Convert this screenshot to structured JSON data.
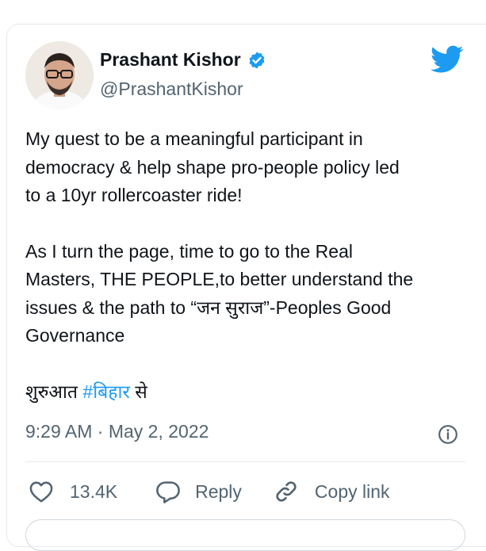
{
  "author": {
    "name": "Prashant Kishor",
    "handle": "@PrashantKishor",
    "verified": true
  },
  "tweet": {
    "paragraph1": [
      "My quest to be a meaningful participant in",
      "democracy & help shape pro-people policy led",
      "to a 10yr rollercoaster ride!"
    ],
    "paragraph2": [
      "As I turn the page, time to go to the Real",
      "Masters, THE PEOPLE,to better understand the",
      "issues & the path to “जन सुराज”-Peoples Good",
      "Governance"
    ],
    "closing_prefix": "शुरुआत ",
    "hashtag": "#बिहार",
    "closing_suffix": " से"
  },
  "timestamp": "9:29 AM · May 2, 2022",
  "actions": {
    "like_count": "13.4K",
    "reply_label": "Reply",
    "copy_label": "Copy link"
  },
  "colors": {
    "brand": "#1d9bf0",
    "text": "#0f1419",
    "secondary": "#536471"
  },
  "icons": [
    "twitter-logo-icon",
    "verified-badge-icon",
    "info-icon",
    "heart-icon",
    "reply-icon",
    "link-icon"
  ]
}
